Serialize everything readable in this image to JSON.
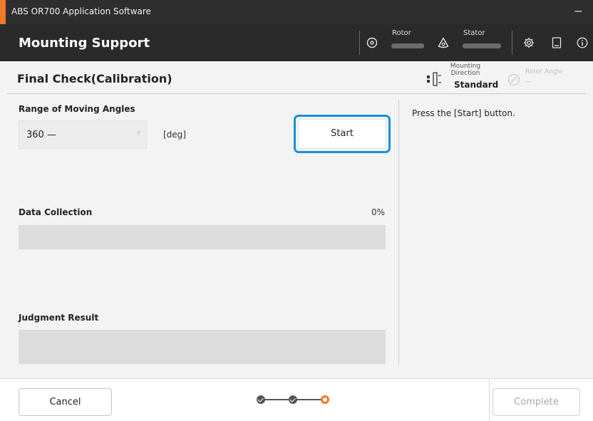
{
  "window": {
    "title": "ABS OR700 Application Software",
    "minimize_glyph": "−"
  },
  "header": {
    "title": "Mounting Support",
    "rotor_label": "Rotor",
    "stator_label": "Stator",
    "icons": [
      "rotor-icon",
      "stator-icon",
      "settings-icon",
      "manual-icon",
      "info-icon"
    ]
  },
  "subheader": {
    "title": "Final Check(Calibration)",
    "mounting_direction": {
      "label": "Mounting Direction",
      "value": "Standard"
    },
    "rotor_angle": {
      "label": "Rotor Angle",
      "value": "—"
    }
  },
  "range": {
    "label": "Range of Moving Angles",
    "selected": "360 —",
    "unit": "[deg]"
  },
  "start_label": "Start",
  "data_collection": {
    "label": "Data Collection",
    "percent_text": "0%",
    "progress": 0
  },
  "judgment": {
    "label": "Judgment Result"
  },
  "instruction": "Press the [Start] button.",
  "footer": {
    "cancel_label": "Cancel",
    "complete_label": "Complete",
    "steps": [
      "done",
      "done",
      "current"
    ]
  },
  "colors": {
    "accent": "#f0782a",
    "focus": "#1792d6",
    "header_bg": "#2a2a2a"
  }
}
